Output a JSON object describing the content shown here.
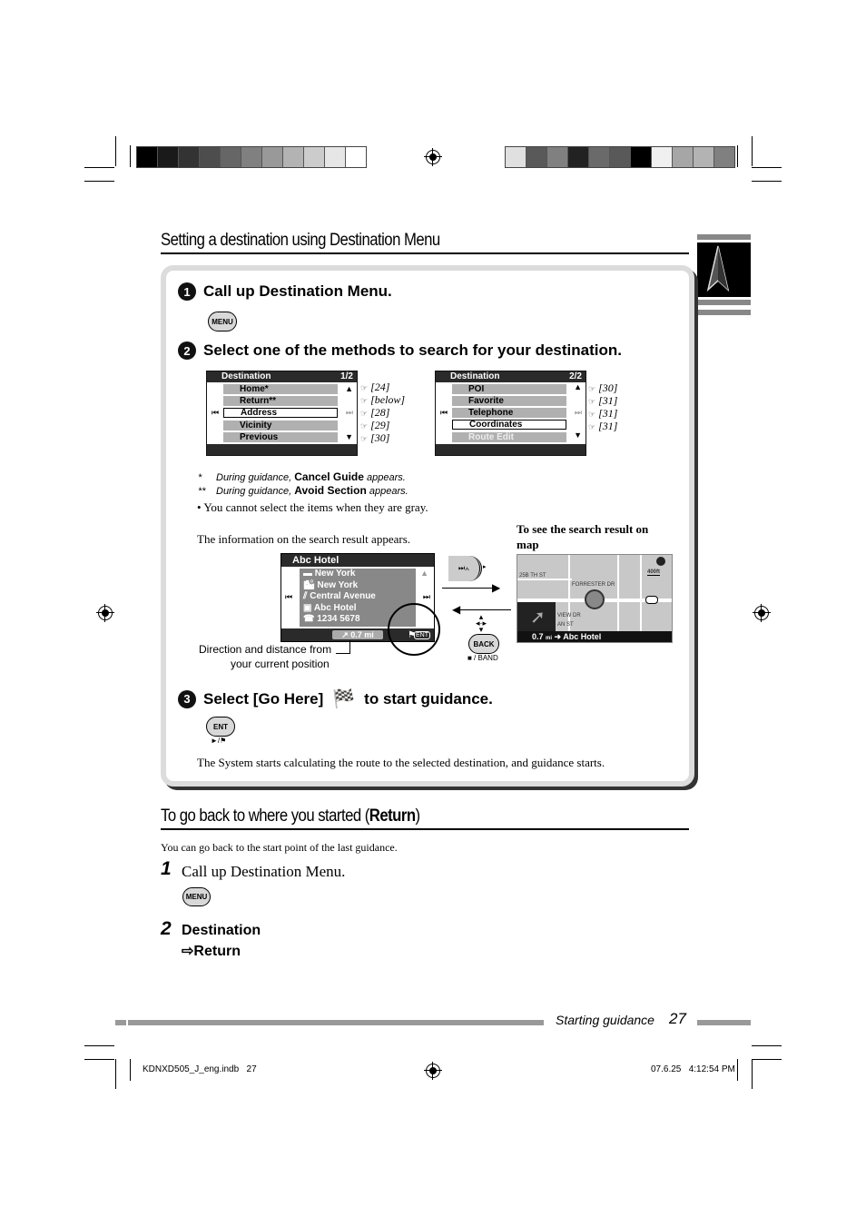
{
  "print_marks": {
    "left_bar_colors": [
      "#000000",
      "#1a1a1a",
      "#333333",
      "#4d4d4d",
      "#666666",
      "#808080",
      "#999999",
      "#b3b3b3",
      "#cccccc",
      "#e6e6e6",
      "#ffffff"
    ],
    "right_bar_colors": [
      "#e0e0e0",
      "#595959",
      "#808080",
      "#222222",
      "#6a6a6a",
      "#595959",
      "#000000",
      "#f0f0f0",
      "#a6a6a6",
      "#b3b3b3",
      "#808080"
    ]
  },
  "section1": {
    "title": "Setting a destination using Destination Menu",
    "step1": {
      "num": "1",
      "text": "Call up Destination Menu.",
      "button": "MENU"
    },
    "step2": {
      "num": "2",
      "text": "Select one of the methods to search for your destination."
    },
    "screen1": {
      "header": "Destination",
      "page": "1/2",
      "items": [
        {
          "label": "Home*",
          "ref": "[24]"
        },
        {
          "label": "Return**",
          "ref": "[below]"
        },
        {
          "label": "Address",
          "ref": "[28]",
          "selected": true
        },
        {
          "label": "Vicinity",
          "ref": "[29]"
        },
        {
          "label": "Previous",
          "ref": "[30]"
        }
      ]
    },
    "screen2": {
      "header": "Destination",
      "page": "2/2",
      "items": [
        {
          "label": "POI",
          "ref": "[30]"
        },
        {
          "label": "Favorite",
          "ref": "[31]"
        },
        {
          "label": "Telephone",
          "ref": "[31]"
        },
        {
          "label": "Coordinates",
          "ref": "[31]",
          "selected": true
        },
        {
          "label": "Route Edit",
          "gray": true
        }
      ]
    },
    "notes": {
      "n1_mark": "*",
      "n1_pre": "During guidance,",
      "n1_bold": "Cancel Guide",
      "n1_post": "appears.",
      "n2_mark": "**",
      "n2_pre": "During guidance,",
      "n2_bold": "Avoid Section",
      "n2_post": "appears.",
      "bullet": "• You cannot select the items when they are gray."
    },
    "result_intro": "The information on the search result appears.",
    "result_screen": {
      "header": "Abc Hotel",
      "rows": [
        "New York",
        "New York",
        "Central Avenue",
        "Abc Hotel",
        "1234 5678"
      ],
      "distance": "0.7 mi"
    },
    "map_caption": "To see the search result on map",
    "map": {
      "labels": [
        "25B TH ST",
        "FORRESTER DR",
        "VIEW DR",
        "AN ST"
      ],
      "scale": "400ft",
      "bottom_distance": "0.7",
      "bottom_unit": "mi",
      "bottom_dest": "Abc Hotel"
    },
    "direction_caption_1": "Direction and distance from",
    "direction_caption_2": "your current position",
    "back_button": "BACK",
    "back_sub": "■ / BAND",
    "step3": {
      "num": "3",
      "pre": "Select [Go Here]",
      "post": "to start guidance.",
      "button": "ENT",
      "button_sub": "►/⚑"
    },
    "final_text": "The System starts calculating the route to the selected destination, and guidance starts."
  },
  "section2": {
    "title_pre": "To go back to where you started (",
    "title_bold": "Return",
    "title_post": ")",
    "intro": "You can go back to the start point of the last guidance.",
    "step1": {
      "num": "1",
      "text": "Call up Destination Menu.",
      "button": "MENU"
    },
    "step2": {
      "num": "2",
      "line1": "Destination",
      "line2": "⇨Return"
    }
  },
  "footer": {
    "section_label": "Starting guidance",
    "page_number": "27",
    "file": "KDNXD505_J_eng.indb   27",
    "timestamp": "07.6.25   4:12:54 PM"
  }
}
